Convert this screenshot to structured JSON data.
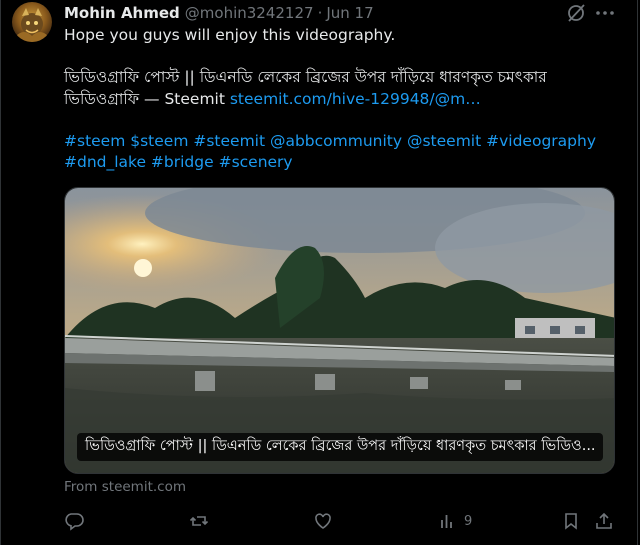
{
  "author": {
    "name": "Mohin Ahmed",
    "handle": "@mohin3242127",
    "separator": "·",
    "date": "Jun 17"
  },
  "tweet": {
    "line1": "Hope you guys will enjoy this videography.",
    "line2": "ভিডিওগ্রাফি পোস্ট || ডিএনডি লেকের ব্রিজের উপর দাঁড়িয়ে ধারণকৃত চমৎকার",
    "line3_text": "ভিডিওগ্রাফি — Steemit ",
    "line3_link": "steemit.com/hive-129948/@m…",
    "hashtags_line1": "#steem $steem #steemit @abbcommunity @steemit #videography",
    "hashtags_line2": "#dnd_lake #bridge #scenery"
  },
  "card": {
    "caption": "ভিডিওগ্রাফি পোস্ট || ডিএনডি লেকের ব্রিজের উপর দাঁড়িয়ে ধারণকৃত চমৎকার ভিডিও...",
    "from": "From steemit.com"
  },
  "actions": {
    "views_count": "9"
  },
  "icons": {
    "avatar": "avatar",
    "grok": "grok-icon",
    "more": "more-icon",
    "reply": "reply-icon",
    "retweet": "retweet-icon",
    "like": "like-icon",
    "views": "views-icon",
    "bookmark": "bookmark-icon",
    "share": "share-icon"
  },
  "colors": {
    "link": "#1d9bf0",
    "muted": "#71767b",
    "text": "#e7e9ea",
    "background": "#000000"
  }
}
